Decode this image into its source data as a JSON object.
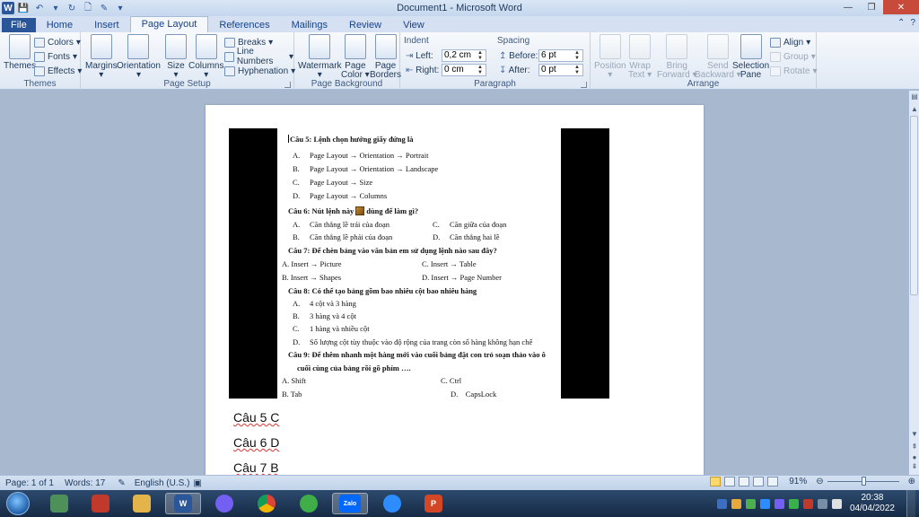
{
  "window": {
    "title": "Document1 - Microsoft Word",
    "controls": [
      "—",
      "❐",
      "✕"
    ]
  },
  "qat": {
    "logo": "W"
  },
  "tabs": [
    "File",
    "Home",
    "Insert",
    "Page Layout",
    "References",
    "Mailings",
    "Review",
    "View"
  ],
  "ribbon": {
    "themes": {
      "themes": "Themes",
      "colors": "Colors",
      "fonts": "Fonts",
      "effects": "Effects",
      "group": "Themes"
    },
    "page_setup": {
      "margins": "Margins",
      "orientation": "Orientation",
      "size": "Size",
      "columns": "Columns",
      "breaks": "Breaks",
      "line_numbers": "Line Numbers",
      "hyphenation": "Hyphenation",
      "group": "Page Setup"
    },
    "page_background": {
      "watermark": "Watermark",
      "page_color_1": "Page",
      "page_color_2": "Color",
      "page_borders_1": "Page",
      "page_borders_2": "Borders",
      "group": "Page Background"
    },
    "paragraph": {
      "indent": "Indent",
      "left_label": "Left:",
      "left_value": "0,2 cm",
      "right_label": "Right:",
      "right_value": "0 cm",
      "spacing": "Spacing",
      "before_label": "Before:",
      "before_value": "6 pt",
      "after_label": "After:",
      "after_value": "0 pt",
      "group": "Paragraph"
    },
    "arrange": {
      "position": "Position",
      "wrap_1": "Wrap",
      "wrap_2": "Text",
      "bring_1": "Bring",
      "bring_2": "Forward",
      "send_1": "Send",
      "send_2": "Backward",
      "selection_1": "Selection",
      "selection_2": "Pane",
      "align": "Align",
      "group_btn": "Group",
      "rotate": "Rotate",
      "group": "Arrange"
    }
  },
  "document": {
    "q5_title": "Câu 5: Lệnh chọn hướng giấy đứng là",
    "q5_options": [
      {
        "letter": "A.",
        "text": "Page Layout → Orientation → Portrait"
      },
      {
        "letter": "B.",
        "text": "Page Layout → Orientation → Landscape"
      },
      {
        "letter": "C.",
        "text": "Page Layout → Size"
      },
      {
        "letter": "D.",
        "text": "Page Layout → Columns"
      }
    ],
    "q6_title_a": "Câu 6: Nút lệnh này",
    "q6_title_b": "dùng để làm gì?",
    "q6_options": [
      {
        "letter": "A.",
        "text": "Căn thẳng lề trái của đoạn"
      },
      {
        "letter": "C.",
        "text": "Căn giữa của đoạn"
      },
      {
        "letter": "B.",
        "text": "Căn thẳng lề phải của đoạn"
      },
      {
        "letter": "D.",
        "text": "Căn thẳng hai lề"
      }
    ],
    "q7_title": "Câu 7: Để chèn bảng vào văn bản em sử dụng lệnh nào sau đây?",
    "q7_options": [
      "A. Insert → Picture",
      "C. Insert → Table",
      "B. Insert → Shapes",
      "D. Insert → Page Number"
    ],
    "q8_title": "Câu 8: Có thể tạo bảng gồm bao nhiêu cột bao nhiêu hàng",
    "q8_options": [
      {
        "letter": "A.",
        "text": "4 cột và 3 hàng"
      },
      {
        "letter": "B.",
        "text": "3 hàng và 4 cột"
      },
      {
        "letter": "C.",
        "text": "1 hàng và nhiều cột"
      },
      {
        "letter": "D.",
        "text": "Số lượng cột tùy thuộc vào độ rộng của trang còn số hàng không hạn chế"
      }
    ],
    "q9_title_1": "Câu 9: Để thêm nhanh một hàng mới vào cuối bảng đặt con trỏ soạn thảo vào ô",
    "q9_title_2": "cuối cùng của bảng rồi gõ phím ….",
    "q9_options": [
      "A. Shift",
      "C. Ctrl",
      "B. Tab",
      "D.",
      "CapsLock"
    ],
    "typed_1": "Câu 5 C",
    "typed_2": "Câu 6 D",
    "typed_3": "Câu 7 B"
  },
  "status": {
    "page": "Page: 1 of 1",
    "words": "Words: 17",
    "language": "English (U.S.)",
    "zoom": "91%"
  },
  "taskbar": {
    "apps": [
      "explorer-libraries",
      "app-red",
      "file-explorer",
      "word",
      "viber",
      "chrome",
      "cococ",
      "zalo",
      "zoom",
      "powerpoint"
    ],
    "zalo_label": "Zalo",
    "time": "20:38",
    "date": "04/04/2022"
  }
}
